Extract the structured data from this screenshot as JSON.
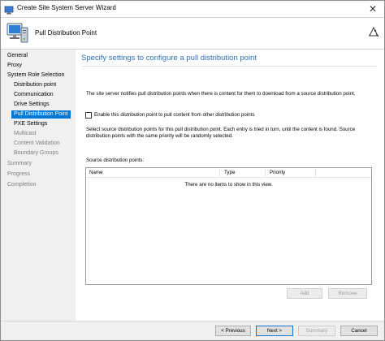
{
  "window": {
    "title": "Create Site System Server Wizard",
    "close_glyph": "✕"
  },
  "header": {
    "title": "Pull Distribution Point",
    "icon": "server-computer-icon",
    "right_icon": "wizard-hat-icon"
  },
  "nav": {
    "items": [
      {
        "label": "General",
        "state": "normal"
      },
      {
        "label": "Proxy",
        "state": "normal"
      },
      {
        "label": "System Role Selection",
        "state": "normal"
      },
      {
        "label": "Distribution point",
        "state": "normal"
      },
      {
        "label": "Communication",
        "state": "normal"
      },
      {
        "label": "Drive Settings",
        "state": "normal"
      },
      {
        "label": "Pull Distribution Point",
        "state": "selected"
      },
      {
        "label": "PXE Settings",
        "state": "normal"
      },
      {
        "label": "Multicast",
        "state": "disabled"
      },
      {
        "label": "Content Validation",
        "state": "disabled"
      },
      {
        "label": "Boundary Groups",
        "state": "disabled"
      },
      {
        "label": "Summary",
        "state": "disabled"
      },
      {
        "label": "Progress",
        "state": "disabled"
      },
      {
        "label": "Completion",
        "state": "disabled"
      }
    ]
  },
  "content": {
    "heading": "Specify settings to configure a pull distribution point",
    "description": "The site server notifies pull distribution points when there is content for them to download from a source distribution point.",
    "checkbox_label": "Enable this distribution point to pull content from other distribution points",
    "checkbox_checked": false,
    "select_description": "Select source distribution points for this pull distribution point.  Each entry is tried in turn, until the content is found.  Source distribution points with the same priority will be randomly selected.",
    "list_label": "Source distribution points:",
    "list": {
      "columns": [
        "Name",
        "Type",
        "Priority"
      ],
      "empty_message": "There are no items to show in this view."
    },
    "add_button": "Add",
    "remove_button": "Remove"
  },
  "footer": {
    "previous": "< Previous",
    "next": "Next >",
    "summary": "Summary",
    "cancel": "Cancel"
  },
  "colors": {
    "accent": "#0078d7",
    "heading": "#2e6fb5"
  }
}
